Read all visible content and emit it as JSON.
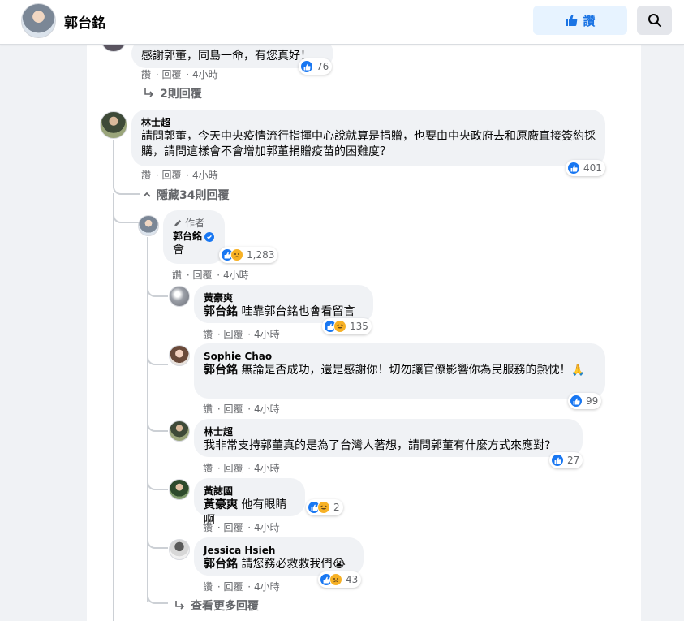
{
  "page": {
    "name": "郭台銘",
    "like_label": "讚"
  },
  "actions": {
    "like": "讚",
    "reply": "回覆"
  },
  "comment0": {
    "text": "感謝郭董，同島一命，有您真好！",
    "time": "4小時",
    "reactions": "76",
    "replies_link": "2則回覆"
  },
  "comment1": {
    "author": "林士超",
    "text": "請問郭董，今天中央疫情流行指揮中心說就算是捐贈，也要由中央政府去和原廠直接簽約採購，請問這樣會不會增加郭董捐贈疫苗的困難度？",
    "time": "4小時",
    "reactions": "401",
    "hide_link": "隱藏34則回覆"
  },
  "replies": [
    {
      "badge": "作者",
      "author": "郭台銘",
      "text": "會",
      "time": "4小時",
      "reactions": "1,283"
    },
    {
      "author": "黃豪爽",
      "mention": "郭台銘",
      "text": "哇靠郭台銘也會看留言",
      "time": "4小時",
      "reactions": "135"
    },
    {
      "author": "Sophie Chao",
      "mention": "郭台銘",
      "text": "無論是否成功，還是感謝你！切勿讓官僚影響你為民服務的熱忱！🙏",
      "time": "4小時",
      "reactions": "99"
    },
    {
      "author": "林士超",
      "text": "我非常支持郭董真的是為了台灣人著想，請問郭董有什麼方式來應對?",
      "time": "4小時",
      "reactions": "27"
    },
    {
      "author": "黃誌國",
      "mention": "黃豪爽",
      "text": "他有眼睛啊",
      "time": "4小時",
      "reactions": "2"
    },
    {
      "author": "Jessica Hsieh",
      "mention": "郭台銘",
      "text": "請您務必救救我們😭",
      "time": "4小時",
      "reactions": "43"
    }
  ],
  "more_replies": "查看更多回覆",
  "colors": {
    "accent": "#1877f2",
    "bubble": "#f0f2f5",
    "muted": "#65676b"
  },
  "icons": {
    "like": "thumbs-up-icon",
    "search": "search-icon",
    "reply_arrow": "reply-arrow-icon",
    "chevron": "chevron-up-icon",
    "pencil": "pencil-icon"
  }
}
